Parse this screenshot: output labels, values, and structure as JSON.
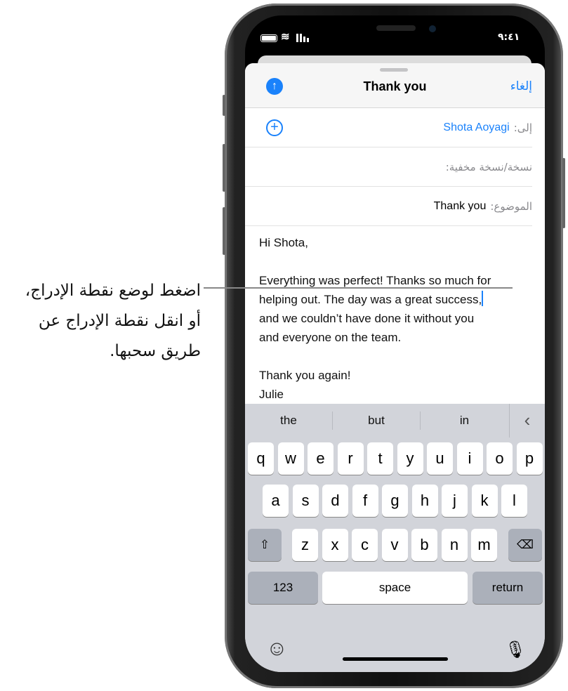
{
  "callout": {
    "lines": [
      "اضغط لوضع نقطة الإدراج،",
      "أو انقل نقطة الإدراج عن",
      "طريق سحبها."
    ]
  },
  "status": {
    "time": "٩:٤١"
  },
  "header": {
    "title": "Thank you",
    "cancel": "إلغاء",
    "send_icon": "arrow-up-circle-icon"
  },
  "fields": {
    "to_label": "إلى:",
    "to_value": "Shota Aoyagi",
    "cc_label": "نسخة/نسخة مخفية:",
    "subject_label": "الموضوع:",
    "subject_value": "Thank you"
  },
  "body": {
    "greeting": "Hi Shota,",
    "para1_before": "Everything was perfect! Thanks so much for\nhelping out. The day was a great success,",
    "para1_after": "\nand we couldn’t have done it without you\nand everyone on the team.",
    "closing": "Thank you again!\nJulie"
  },
  "keyboard": {
    "suggestions": [
      "the",
      "but",
      "in"
    ],
    "row1": [
      "q",
      "w",
      "e",
      "r",
      "t",
      "y",
      "u",
      "i",
      "o",
      "p"
    ],
    "row2": [
      "a",
      "s",
      "d",
      "f",
      "g",
      "h",
      "j",
      "k",
      "l"
    ],
    "row3": [
      "z",
      "x",
      "c",
      "v",
      "b",
      "n",
      "m"
    ],
    "numbers": "123",
    "space": "space",
    "return": "return",
    "shift": "⇧",
    "delete": "⌫",
    "emoji": "☺",
    "mic": "🎙"
  },
  "colors": {
    "accent": "#1a82fb"
  }
}
